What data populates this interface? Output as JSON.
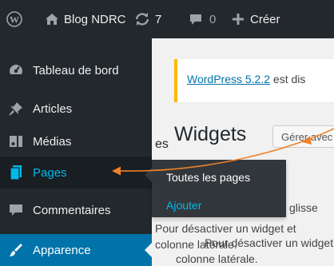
{
  "adminbar": {
    "site_name": "Blog NDRC",
    "updates_count": "7",
    "comments_count": "0",
    "new_label": "Créer"
  },
  "sidebar": {
    "items": [
      {
        "label": "Tableau de bord",
        "icon": "dashboard-icon"
      },
      {
        "label": "Articles",
        "icon": "pin-icon"
      },
      {
        "label": "Médias",
        "icon": "media-icon"
      },
      {
        "label": "Pages",
        "icon": "pages-icon"
      },
      {
        "label": "Commentaires",
        "icon": "comment-icon"
      },
      {
        "label": "Apparence",
        "icon": "appearance-icon"
      }
    ]
  },
  "flyout": {
    "items": [
      "Toutes les pages",
      "Ajouter"
    ]
  },
  "notice": {
    "link": "WordPress 5.2.2",
    "text": " est dis"
  },
  "page": {
    "title": "Widgets",
    "action_button": "Gérer avec",
    "section_heading_partial": "es",
    "description_lines": [
      "glisse",
      "Pour désactiver un widget et",
      "colonne latérale."
    ]
  },
  "colors": {
    "adminbar_bg": "#23282d",
    "sidebar_bg": "#23282d",
    "current_item": "#0073aa",
    "hover_text": "#00b9eb",
    "notice_border": "#ffb900",
    "annotation_arrow": "#f0822a"
  }
}
